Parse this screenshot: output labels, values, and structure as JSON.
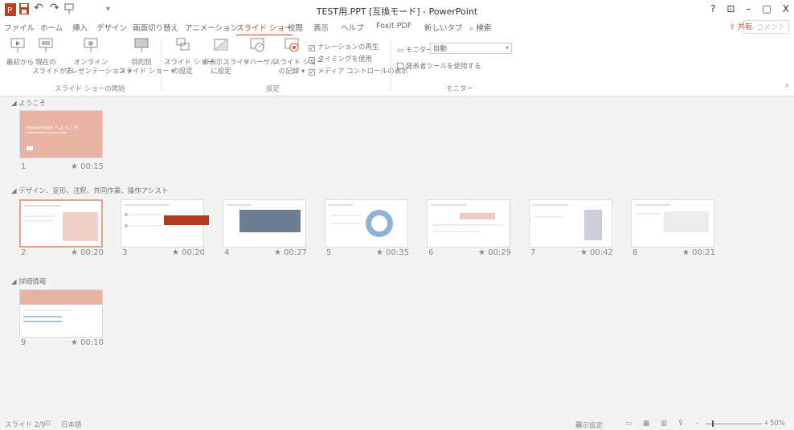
{
  "window": {
    "title": "TEST用.PPT [互換モード] - PowerPoint",
    "controls": [
      "?",
      "⊡",
      "–",
      "□",
      "X"
    ]
  },
  "colors": {
    "accent": "#b7472a",
    "slide_pink": "#e8b3a2"
  },
  "quick_access": {
    "undo": "↶",
    "redo": "↷",
    "more": "▾"
  },
  "tabs": [
    "ファイル",
    "ホーム",
    "挿入",
    "デザイン",
    "画面切り替え",
    "アニメーション",
    "スライド ショー",
    "校閲",
    "表示",
    "ヘルプ",
    "Foxit PDF",
    "新しいタブ",
    "検索"
  ],
  "active_tab": "スライド ショー",
  "share_label": "共有",
  "comment_label": "コメント",
  "ribbon": {
    "start_group": {
      "label": "スライド ショーの開始",
      "buttons": [
        {
          "l1": "最初から",
          "l2": ""
        },
        {
          "l1": "現在の",
          "l2": "スライドから"
        },
        {
          "l1": "オンライン",
          "l2": "プレゼンテーション ▾"
        },
        {
          "l1": "目的別",
          "l2": "スライド ショー ▾"
        }
      ]
    },
    "setup_group": {
      "label": "設定",
      "buttons": [
        {
          "l1": "スライド ショー",
          "l2": "の設定"
        },
        {
          "l1": "非表示スライド",
          "l2": "に設定"
        },
        {
          "l1": "リハーサル",
          "l2": ""
        },
        {
          "l1": "スライド ショー",
          "l2": "の記録 ▾"
        }
      ],
      "checks": [
        "ナレーションの再生",
        "タイミングを使用",
        "メディア コントロールの表示"
      ]
    },
    "monitor_group": {
      "label": "モニター",
      "monitor_label": "モニター:",
      "monitor_value": "自動",
      "presenter_check": "発表者ツールを使用する"
    }
  },
  "sections": [
    {
      "title": "ようこそ"
    },
    {
      "title": "デザイン、変形、注釈、共同作業、操作アシスト"
    },
    {
      "title": "詳細情報"
    }
  ],
  "slides": [
    {
      "number": "1",
      "time": "00:15",
      "caption": "PowerPoint へようこそ"
    },
    {
      "number": "2",
      "time": "00:20"
    },
    {
      "number": "3",
      "time": "00:20"
    },
    {
      "number": "4",
      "time": "00:27"
    },
    {
      "number": "5",
      "time": "00:35"
    },
    {
      "number": "6",
      "time": "00:29"
    },
    {
      "number": "7",
      "time": "00:42"
    },
    {
      "number": "8",
      "time": "00:21"
    },
    {
      "number": "9",
      "time": "00:10"
    }
  ],
  "status": {
    "slide_info": "スライド 2/9",
    "language": "日本語",
    "display_settings": "表示設定",
    "zoom": "50%"
  }
}
